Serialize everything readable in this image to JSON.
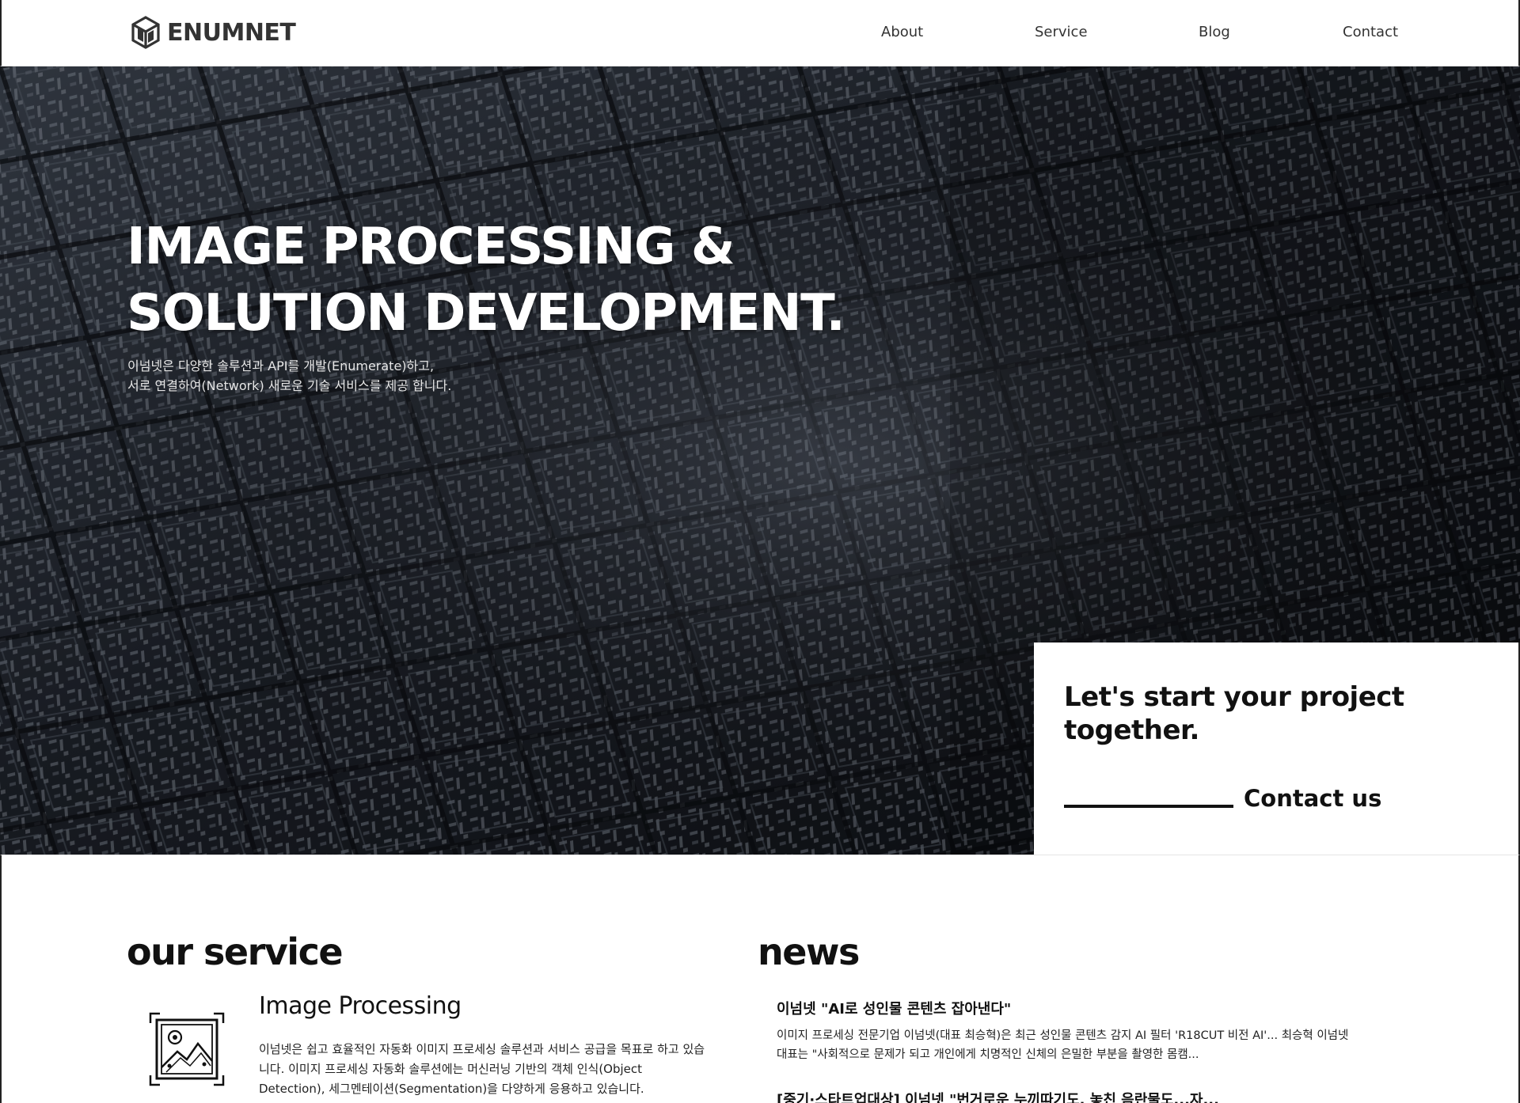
{
  "header": {
    "logo_text": "ENUMNET",
    "logo_icon": "cube-logo-icon",
    "nav": [
      {
        "label": "About"
      },
      {
        "label": "Service"
      },
      {
        "label": "Blog"
      },
      {
        "label": "Contact"
      }
    ]
  },
  "hero": {
    "title_line1": "IMAGE PROCESSING &",
    "title_line2": "SOLUTION DEVELOPMENT.",
    "desc_line1": "이넘넷은 다양한 솔루션과 API를 개발(Enumerate)하고,",
    "desc_line2": "서로 연결하여(Network) 새로운 기술 서비스를 제공 합니다.",
    "cta_title_line1": "Let's start your project",
    "cta_title_line2": "together.",
    "cta_link": "Contact us"
  },
  "service": {
    "section_title": "our service",
    "items": [
      {
        "icon": "image-frame-icon",
        "name": "Image Processing",
        "desc": "이넘넷은 쉽고 효율적인 자동화 이미지 프로세싱 솔루션과 서비스 공급을 목표로 하고 있습니다. 이미지 프로세싱 자동화 솔루션에는 머신러닝 기반의 객체 인식(Object Detection), 세그멘테이션(Segmentation)을 다양하게 응용하고 있습니다."
      }
    ]
  },
  "news": {
    "section_title": "news",
    "items": [
      {
        "title": "이넘넷 \"AI로 성인물 콘텐츠 잡아낸다\"",
        "desc": "이미지 프로세싱 전문기업 이넘넷(대표 최승혁)은 최근 성인물 콘텐츠 감지 AI 필터 'R18CUT 비전 AI'... 최승혁 이넘넷 대표는 \"사회적으로 문제가 되고 개인에게 치명적인 신체의 은밀한 부분을 촬영한 몸캠..."
      },
      {
        "title": "[중기·스타트업대상] 이넘넷 \"번거로운 누끼따기도, 놓친 음란물도...자..."
      }
    ]
  },
  "colors": {
    "text": "#111111",
    "hero_bg": "#14171d",
    "white": "#ffffff"
  }
}
